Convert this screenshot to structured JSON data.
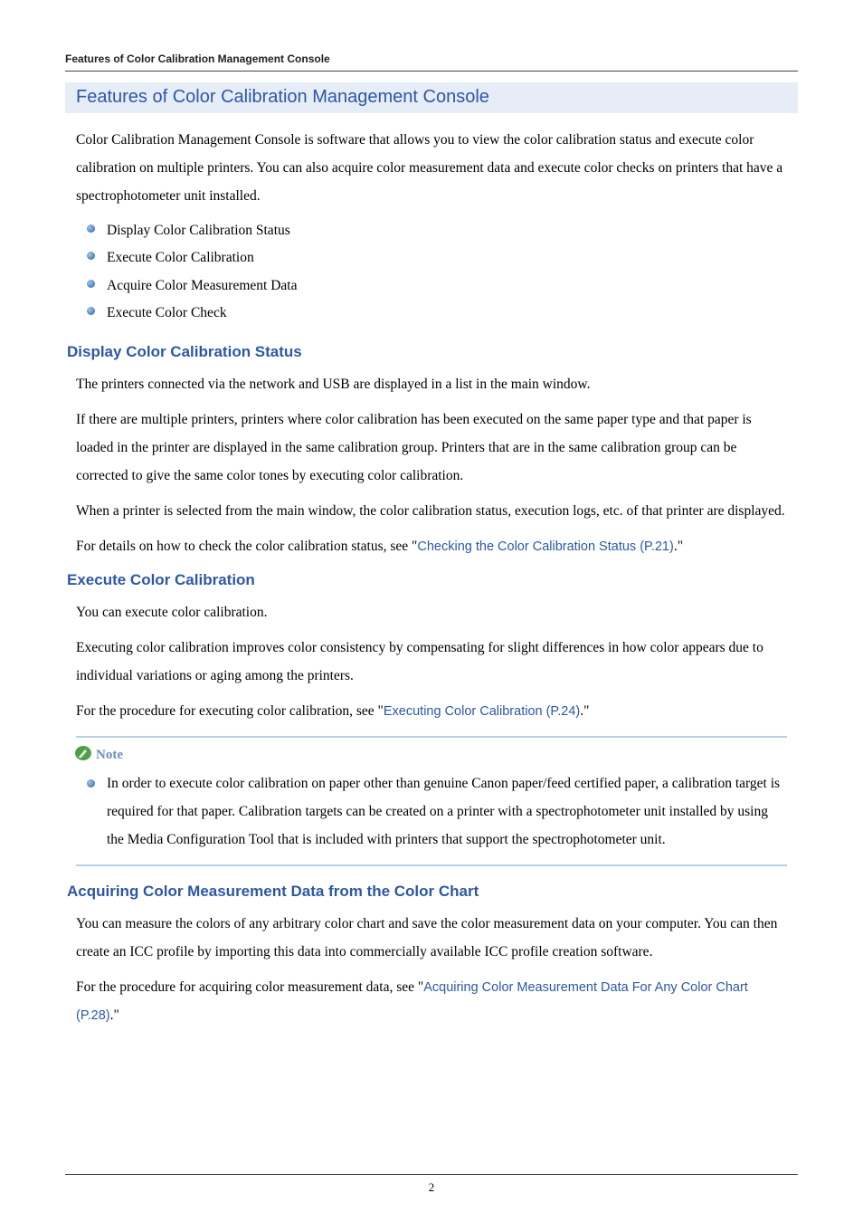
{
  "running_head": "Features of Color Calibration Management Console",
  "title": "Features of Color Calibration Management Console",
  "intro": "Color Calibration Management Console is software that allows you to view the color calibration status and execute color calibration on multiple printers. You can also acquire color measurement data and execute color checks on printers that have a spectrophotometer unit installed.",
  "feature_list": [
    "Display Color Calibration Status",
    "Execute Color Calibration",
    "Acquire Color Measurement Data",
    "Execute Color Check"
  ],
  "sections": {
    "display": {
      "heading": "Display Color Calibration Status",
      "p1": "The printers connected via the network and USB are displayed in a list in the main window.",
      "p2": "If there are multiple printers, printers where color calibration has been executed on the same paper type and that paper is loaded in the printer are displayed in the same calibration group. Printers that are in the same calibration group can be corrected to give the same color tones by executing color calibration.",
      "p3": "When a printer is selected from the main window, the color calibration status, execution logs, etc. of that printer are displayed.",
      "p4_pre": "For details on how to check the color calibration status, see \"",
      "p4_link": "Checking the Color Calibration Status (P.21)",
      "p4_post": ".\""
    },
    "execute": {
      "heading": "Execute Color Calibration",
      "p1": "You can execute color calibration.",
      "p2": "Executing color calibration improves color consistency by compensating for slight differences in how color appears due to individual variations or aging among the printers.",
      "p3_pre": "For the procedure for executing color calibration, see \"",
      "p3_link": "Executing Color Calibration (P.24)",
      "p3_post": ".\""
    },
    "note": {
      "label": "Note",
      "item": "In order to execute color calibration on paper other than genuine Canon paper/feed certified paper, a calibration target is required for that paper. Calibration targets can be created on a printer with a spectrophotometer unit installed by using the Media Configuration Tool that is included with printers that support the spectrophotometer unit."
    },
    "acquire": {
      "heading": "Acquiring Color Measurement Data from the Color Chart",
      "p1": "You can measure the colors of any arbitrary color chart and save the color measurement data on your computer. You can then create an ICC profile by importing this data into commercially available ICC profile creation software.",
      "p2_pre": "For the procedure for acquiring color measurement data, see \"",
      "p2_link": "Acquiring Color Measurement Data For Any Color Chart (P.28)",
      "p2_post": ".\""
    }
  },
  "page_number": "2"
}
